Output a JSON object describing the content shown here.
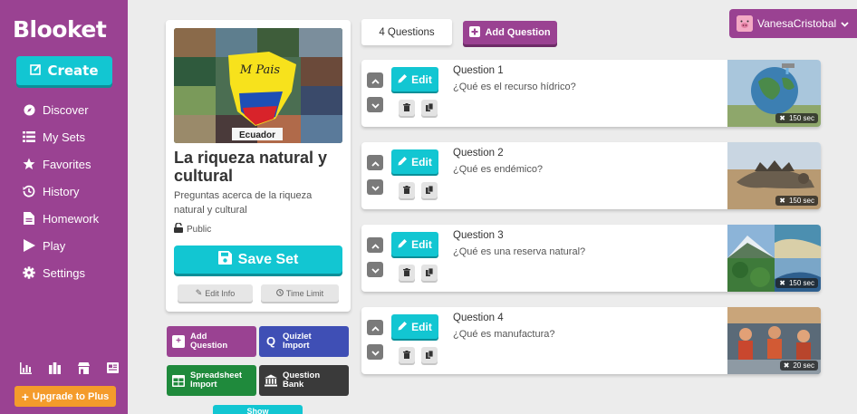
{
  "sidebar": {
    "logo": "Blooket",
    "create_label": "Create",
    "items": [
      {
        "label": "Discover",
        "icon": "compass-icon"
      },
      {
        "label": "My Sets",
        "icon": "list-icon"
      },
      {
        "label": "Favorites",
        "icon": "star-icon"
      },
      {
        "label": "History",
        "icon": "history-icon"
      },
      {
        "label": "Homework",
        "icon": "file-icon"
      },
      {
        "label": "Play",
        "icon": "play-icon"
      },
      {
        "label": "Settings",
        "icon": "gear-icon"
      }
    ],
    "bottom_icons": [
      "stats-icon",
      "blooks-icon",
      "market-icon",
      "news-icon"
    ],
    "upgrade_label": "Upgrade to Plus"
  },
  "set": {
    "cover_label": "Ecuador",
    "cover_badge": "M Pais",
    "title": "La riqueza natural y cultural",
    "description": "Preguntas acerca de la riqueza natural y cultural",
    "visibility": "Public",
    "save_label": "Save Set",
    "edit_info_label": "Edit Info",
    "time_limit_label": "Time Limit"
  },
  "imports": [
    {
      "label": "Add Question",
      "icon": "plus-icon",
      "color": "#9a4292"
    },
    {
      "label": "Quizlet Import",
      "icon": "quizlet-icon",
      "color": "#3f4fb5"
    },
    {
      "label": "Spreadsheet Import",
      "icon": "spreadsheet-icon",
      "color": "#1f8a3c"
    },
    {
      "label": "Question Bank",
      "icon": "bank-icon",
      "color": "#3a3a3a"
    }
  ],
  "show_label": "Show",
  "topbar": {
    "question_count": "4 Questions",
    "add_question_label": "Add Question",
    "username": "VanesaCristobal"
  },
  "questions": [
    {
      "label": "Question 1",
      "text": "¿Qué es el recurso hídrico?",
      "time": "150 sec",
      "image": "water-globe-image"
    },
    {
      "label": "Question 2",
      "text": "¿Qué es endémico?",
      "time": "150 sec",
      "image": "iguana-image"
    },
    {
      "label": "Question 3",
      "text": "¿Qué es una reserva natural?",
      "time": "150 sec",
      "image": "reserve-collage-image"
    },
    {
      "label": "Question 4",
      "text": "¿Qué es manufactura?",
      "time": "20 sec",
      "image": "factory-image"
    }
  ],
  "edit_label": "Edit",
  "colors": {
    "primary": "#9a4292",
    "accent": "#12c6d2",
    "upgrade": "#f49b2b"
  }
}
